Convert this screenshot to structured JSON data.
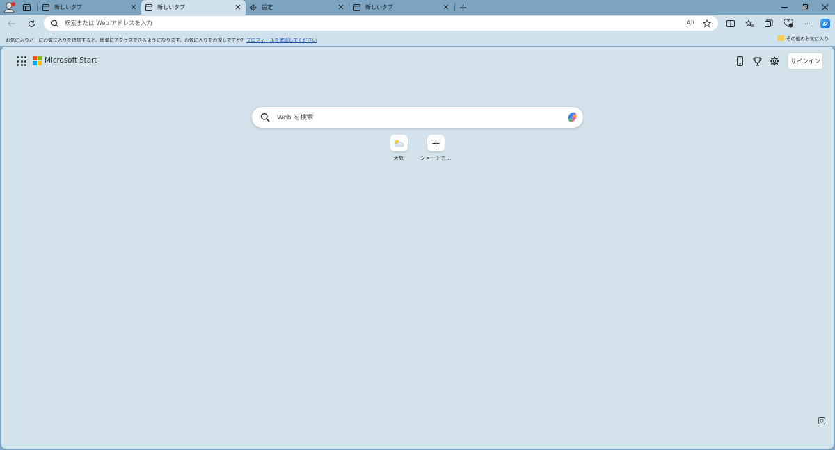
{
  "tabs": [
    {
      "label": "新しいタブ",
      "icon": "newtab-page-icon",
      "active": false
    },
    {
      "label": "新しいタブ",
      "icon": "newtab-page-icon",
      "active": true
    },
    {
      "label": "設定",
      "icon": "gear-icon",
      "active": false
    },
    {
      "label": "新しいタブ",
      "icon": "newtab-page-icon",
      "active": false
    }
  ],
  "toolbar": {
    "address_placeholder": "検索または Web アドレスを入力",
    "read_aloud_label": "A",
    "more_label": "···"
  },
  "favbar": {
    "message": "お気に入りバーにお気に入りを追加すると、簡単にアクセスできるようになります。お気に入りをお探しですか?",
    "link": "プロフィールを確認してください",
    "other_favorites": "その他のお気に入り"
  },
  "header": {
    "brand": "Microsoft Start",
    "signin": "サインイン"
  },
  "search": {
    "placeholder": "Web を検索"
  },
  "shortcuts": [
    {
      "label": "天気",
      "icon": "weather-icon"
    },
    {
      "label": "ショートカ...",
      "icon": "plus-icon"
    }
  ],
  "colors": {
    "tabstrip": "#7ca3c0",
    "toolbar": "#cfe1ec",
    "content": "#d2e3ec",
    "link": "#1a4fb8",
    "ms_red": "#f25022",
    "ms_green": "#7fba00",
    "ms_blue": "#00a4ef",
    "ms_yellow": "#ffb900"
  }
}
